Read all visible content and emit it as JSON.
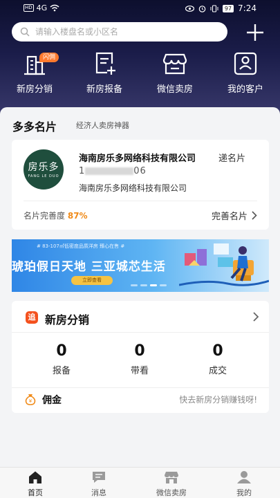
{
  "status_bar": {
    "hd": "HD",
    "network": "4G",
    "battery": "97",
    "time": "7:24"
  },
  "search": {
    "placeholder": "请输入楼盘名或小区名"
  },
  "quick_nav": [
    {
      "label": "新房分销",
      "icon": "building-icon",
      "badge": "闪佣"
    },
    {
      "label": "新房报备",
      "icon": "report-add-icon"
    },
    {
      "label": "微信卖房",
      "icon": "store-icon"
    },
    {
      "label": "我的客户",
      "icon": "customer-card-icon"
    }
  ],
  "card_section": {
    "title": "多多名片",
    "subtitle": "经济人卖房神器",
    "logo_text": "房乐多",
    "logo_subtext": "FANG LE DUO",
    "company_name": "海南房乐多网络科技有限公司",
    "send_card_label": "递名片",
    "phone_prefix": "1",
    "phone_suffix": "06",
    "company_subline": "海南房乐多网络科技有限公司",
    "completeness_label": "名片完善度",
    "completeness_value": "87%",
    "completeness_fraction": 0.87,
    "complete_card_label": "完善名片"
  },
  "banner": {
    "small_text": "# 83-107㎡低密度品质洋房 臻心在售 #",
    "headline": "琥珀假日天地 三亚城芯生活",
    "button_label": "立即查看",
    "slide_count": 4,
    "active_slide": 3
  },
  "distribution": {
    "icon_text": "追",
    "title": "新房分销",
    "stats": [
      {
        "value": "0",
        "label": "报备"
      },
      {
        "value": "0",
        "label": "带看"
      },
      {
        "value": "0",
        "label": "成交"
      }
    ],
    "commission_label": "佣金",
    "commission_hint": "快去新房分销赚钱呀!"
  },
  "tab_bar": [
    {
      "label": "首页",
      "icon": "home-icon",
      "active": true
    },
    {
      "label": "消息",
      "icon": "message-icon",
      "active": false
    },
    {
      "label": "微信卖房",
      "icon": "store-icon",
      "active": false
    },
    {
      "label": "我的",
      "icon": "profile-icon",
      "active": false
    }
  ],
  "colors": {
    "header_dark": "#1b1d4a",
    "accent_orange": "#f08a18",
    "badge_orange": "#ff7a2e",
    "logo_green": "#1f4e3d"
  }
}
